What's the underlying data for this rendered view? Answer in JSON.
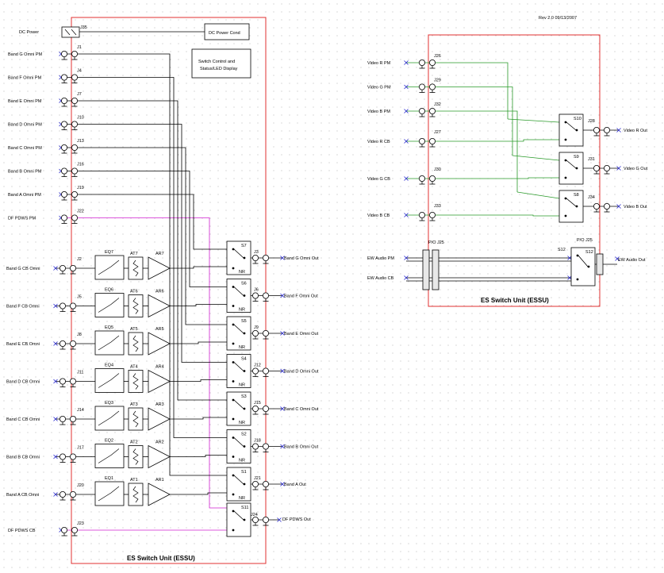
{
  "revision": "Rev 2.0 09/13/2007",
  "unit_title": "ES Switch Unit (ESSU)",
  "dc_power": {
    "label": "DC Power",
    "jack": "J35",
    "target": "DC Power Cond"
  },
  "control_box": "Switch Control and Status/LED Display",
  "pm_inputs": [
    {
      "label": "Band G Omni PM",
      "jack": "J1"
    },
    {
      "label": "Band F Omni PM",
      "jack": "J4"
    },
    {
      "label": "Band E Omni PM",
      "jack": "J7"
    },
    {
      "label": "Band D Omni PM",
      "jack": "J10"
    },
    {
      "label": "Band C Omni PM",
      "jack": "J13"
    },
    {
      "label": "Band B Omni PM",
      "jack": "J16"
    },
    {
      "label": "Band A Omni PM",
      "jack": "J19"
    }
  ],
  "df_pm": {
    "label": "DF PDWS PM",
    "jack": "J22"
  },
  "cb_rows": [
    {
      "label": "Band G CB Omni",
      "in_jack": "J2",
      "eq": "EQ7",
      "at": "AT7",
      "ar": "AR7",
      "sw": "S7",
      "out_jack": "J3",
      "out": "Band G Omni Out"
    },
    {
      "label": "Band F CB Omni",
      "in_jack": "J5",
      "eq": "EQ6",
      "at": "AT6",
      "ar": "AR6",
      "sw": "S6",
      "out_jack": "J6",
      "out": "Band F Omni Out"
    },
    {
      "label": "Band E CB Omni",
      "in_jack": "J8",
      "eq": "EQ5",
      "at": "AT5",
      "ar": "AR5",
      "sw": "S5",
      "out_jack": "J9",
      "out": "Band E Omni Out"
    },
    {
      "label": "Band D CB Omni",
      "in_jack": "J11",
      "eq": "EQ4",
      "at": "AT4",
      "ar": "AR4",
      "sw": "S4",
      "out_jack": "J12",
      "out": "Band D Omni Out"
    },
    {
      "label": "Band C CB Omni",
      "in_jack": "J14",
      "eq": "EQ3",
      "at": "AT3",
      "ar": "AR3",
      "sw": "S3",
      "out_jack": "J15",
      "out": "Band C Omni Out"
    },
    {
      "label": "Band B CB Omni",
      "in_jack": "J17",
      "eq": "EQ2",
      "at": "AT2",
      "ar": "AR2",
      "sw": "S2",
      "out_jack": "J18",
      "out": "Band B Omni Out"
    },
    {
      "label": "Band A CB Omni",
      "in_jack": "J20",
      "eq": "EQ1",
      "at": "AT1",
      "ar": "AR1",
      "sw": "S1",
      "out_jack": "J21",
      "out": "Band A Out"
    }
  ],
  "df_cb": {
    "label": "DF PDWS CB",
    "in_jack": "J23",
    "sw": "S11",
    "out_jack": "J24",
    "out": "DF PDWS Out"
  },
  "switch_pole": "NR",
  "video_pm": [
    {
      "label": "Video R PM",
      "jack": "J26"
    },
    {
      "label": "Video G PM",
      "jack": "J29"
    },
    {
      "label": "Video B PM",
      "jack": "J32"
    }
  ],
  "video_cb": [
    {
      "label": "Video R CB",
      "jack": "J27",
      "sw": "S10",
      "out_jack": "J28",
      "out": "Video R Out"
    },
    {
      "label": "Video G CB",
      "jack": "J30",
      "sw": "S9",
      "out_jack": "J31",
      "out": "Video G Out"
    },
    {
      "label": "Video B CB",
      "jack": "J33",
      "sw": "S8",
      "out_jack": "J34",
      "out": "Video B Out"
    }
  ],
  "audio": {
    "pm_label": "EW Audio PM",
    "cb_label": "EW Audio CB",
    "jack_in": "P/O J25",
    "jack_out": "P/O J25",
    "sw": "S12",
    "out": "EW Audio Out"
  }
}
